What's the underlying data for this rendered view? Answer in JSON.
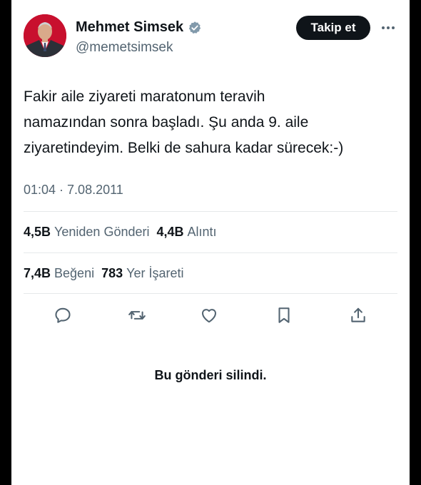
{
  "author": {
    "name": "Mehmet Simsek",
    "handle": "@memetsimsek",
    "avatar_icon": "profile-photo",
    "verified_icon": "verified-badge-icon"
  },
  "follow_button": {
    "label": "Takip et"
  },
  "more_icon": "more-options-icon",
  "tweet": {
    "lines": [
      "Fakir aile ziyareti maratonum teravih",
      "namazından sonra başladı. Şu anda 9. aile",
      "ziyaretindeyim. Belki de sahura kadar sürecek:-)"
    ],
    "timestamp": "01:04 · 7.08.2011"
  },
  "stats": {
    "reposts": {
      "value": "4,5B",
      "label": "Yeniden Gönderi"
    },
    "quotes": {
      "value": "4,4B",
      "label": "Alıntı"
    },
    "likes": {
      "value": "7,4B",
      "label": "Beğeni"
    },
    "bookmarks": {
      "value": "783",
      "label": "Yer İşareti"
    }
  },
  "actions": [
    "reply-icon",
    "repost-icon",
    "like-icon",
    "bookmark-icon",
    "share-icon"
  ],
  "colors": {
    "text": "#0f1419",
    "muted": "#536471",
    "verified": "#829aab",
    "divider": "#e6e9ea"
  },
  "deleted_notice": "Bu gönderi silindi."
}
